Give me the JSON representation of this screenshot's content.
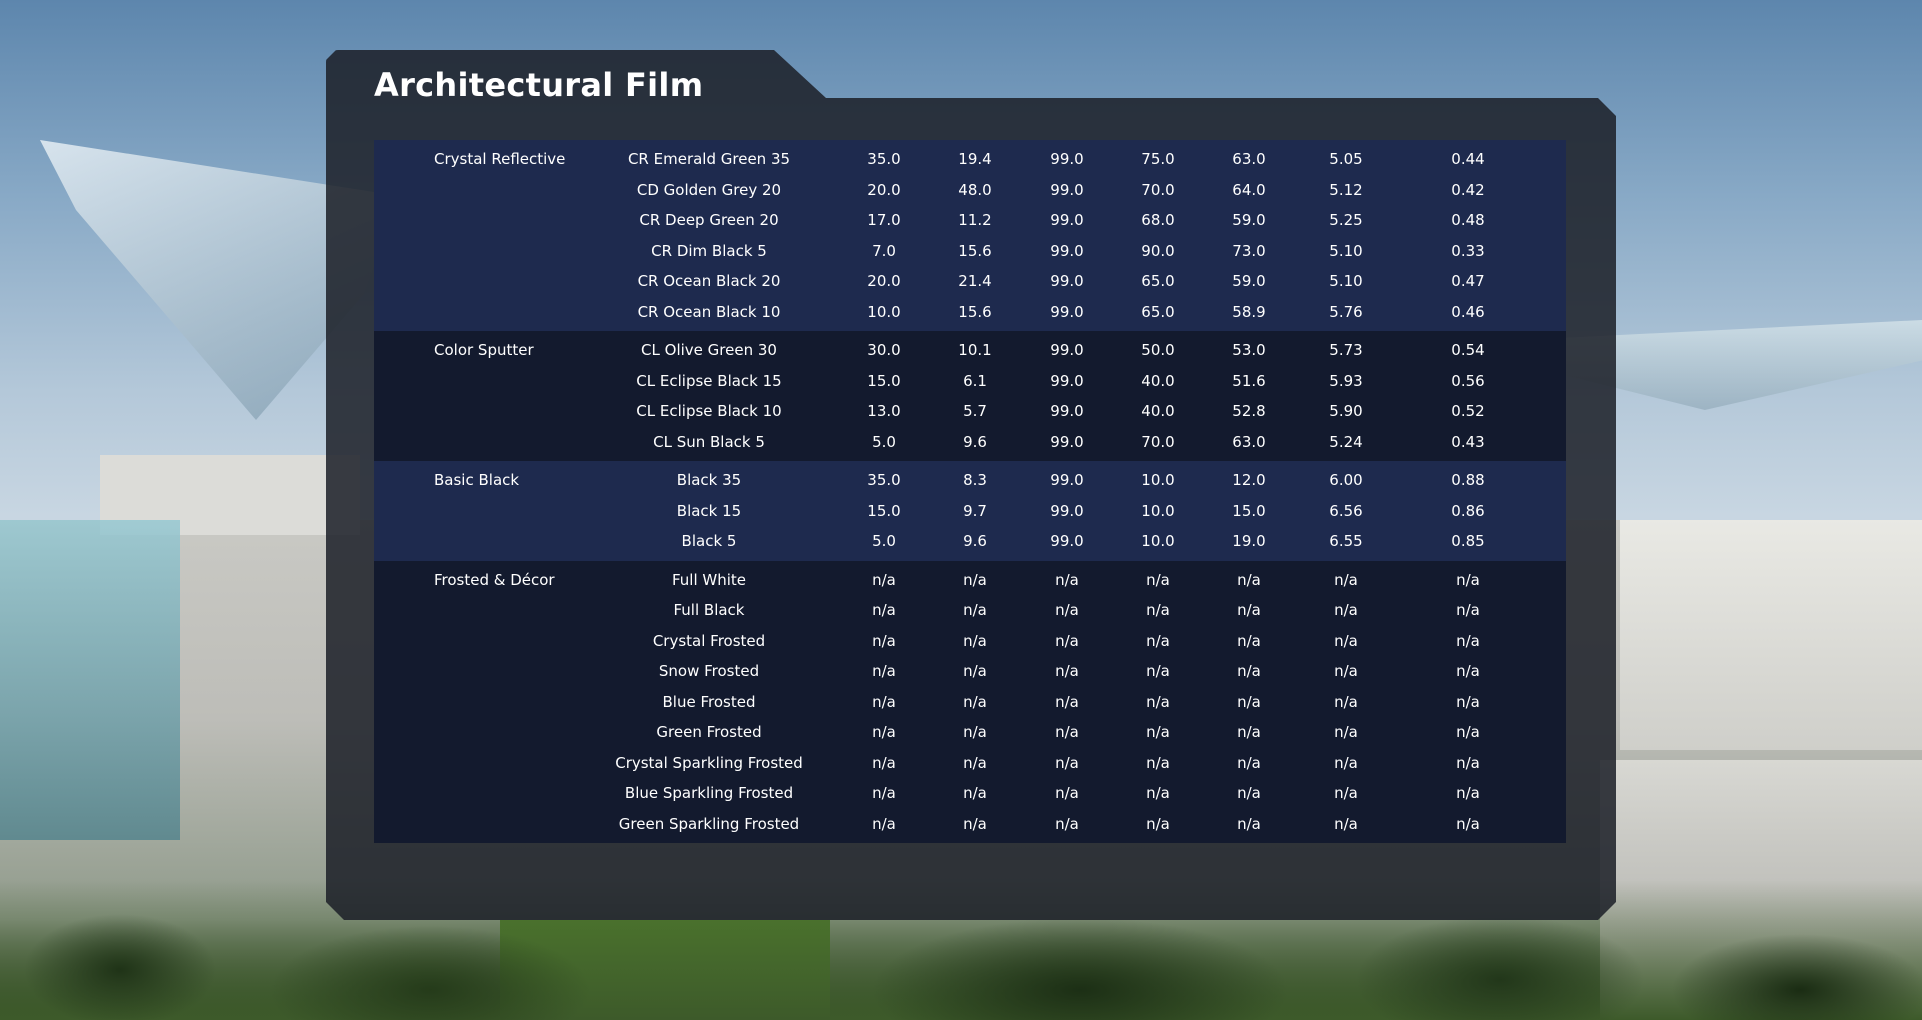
{
  "title": "Architectural Film",
  "groups": [
    {
      "name": "Crystal Reflective",
      "rows": [
        {
          "product": "CR Emerald Green 35",
          "values": [
            "35.0",
            "19.4",
            "99.0",
            "75.0",
            "63.0",
            "5.05",
            "0.44"
          ]
        },
        {
          "product": "CD Golden Grey 20",
          "values": [
            "20.0",
            "48.0",
            "99.0",
            "70.0",
            "64.0",
            "5.12",
            "0.42"
          ]
        },
        {
          "product": "CR Deep Green 20",
          "values": [
            "17.0",
            "11.2",
            "99.0",
            "68.0",
            "59.0",
            "5.25",
            "0.48"
          ]
        },
        {
          "product": "CR Dim Black 5",
          "values": [
            "7.0",
            "15.6",
            "99.0",
            "90.0",
            "73.0",
            "5.10",
            "0.33"
          ]
        },
        {
          "product": "CR Ocean Black 20",
          "values": [
            "20.0",
            "21.4",
            "99.0",
            "65.0",
            "59.0",
            "5.10",
            "0.47"
          ]
        },
        {
          "product": "CR Ocean Black 10",
          "values": [
            "10.0",
            "15.6",
            "99.0",
            "65.0",
            "58.9",
            "5.76",
            "0.46"
          ]
        }
      ]
    },
    {
      "name": "Color Sputter",
      "rows": [
        {
          "product": "CL Olive Green 30",
          "values": [
            "30.0",
            "10.1",
            "99.0",
            "50.0",
            "53.0",
            "5.73",
            "0.54"
          ]
        },
        {
          "product": "CL Eclipse Black 15",
          "values": [
            "15.0",
            "6.1",
            "99.0",
            "40.0",
            "51.6",
            "5.93",
            "0.56"
          ]
        },
        {
          "product": "CL Eclipse Black 10",
          "values": [
            "13.0",
            "5.7",
            "99.0",
            "40.0",
            "52.8",
            "5.90",
            "0.52"
          ]
        },
        {
          "product": "CL Sun Black 5",
          "values": [
            "5.0",
            "9.6",
            "99.0",
            "70.0",
            "63.0",
            "5.24",
            "0.43"
          ]
        }
      ]
    },
    {
      "name": "Basic Black",
      "rows": [
        {
          "product": "Black 35",
          "values": [
            "35.0",
            "8.3",
            "99.0",
            "10.0",
            "12.0",
            "6.00",
            "0.88"
          ]
        },
        {
          "product": "Black 15",
          "values": [
            "15.0",
            "9.7",
            "99.0",
            "10.0",
            "15.0",
            "6.56",
            "0.86"
          ]
        },
        {
          "product": "Black 5",
          "values": [
            "5.0",
            "9.6",
            "99.0",
            "10.0",
            "19.0",
            "6.55",
            "0.85"
          ]
        }
      ]
    },
    {
      "name": "Frosted & Décor",
      "rows": [
        {
          "product": "Full White",
          "values": [
            "n/a",
            "n/a",
            "n/a",
            "n/a",
            "n/a",
            "n/a",
            "n/a"
          ]
        },
        {
          "product": "Full Black",
          "values": [
            "n/a",
            "n/a",
            "n/a",
            "n/a",
            "n/a",
            "n/a",
            "n/a"
          ]
        },
        {
          "product": "Crystal Frosted",
          "values": [
            "n/a",
            "n/a",
            "n/a",
            "n/a",
            "n/a",
            "n/a",
            "n/a"
          ]
        },
        {
          "product": "Snow Frosted",
          "values": [
            "n/a",
            "n/a",
            "n/a",
            "n/a",
            "n/a",
            "n/a",
            "n/a"
          ]
        },
        {
          "product": "Blue Frosted",
          "values": [
            "n/a",
            "n/a",
            "n/a",
            "n/a",
            "n/a",
            "n/a",
            "n/a"
          ]
        },
        {
          "product": "Green Frosted",
          "values": [
            "n/a",
            "n/a",
            "n/a",
            "n/a",
            "n/a",
            "n/a",
            "n/a"
          ]
        },
        {
          "product": "Crystal Sparkling Frosted",
          "values": [
            "n/a",
            "n/a",
            "n/a",
            "n/a",
            "n/a",
            "n/a",
            "n/a"
          ]
        },
        {
          "product": "Blue Sparkling Frosted",
          "values": [
            "n/a",
            "n/a",
            "n/a",
            "n/a",
            "n/a",
            "n/a",
            "n/a"
          ]
        },
        {
          "product": "Green Sparkling Frosted",
          "values": [
            "n/a",
            "n/a",
            "n/a",
            "n/a",
            "n/a",
            "n/a",
            "n/a"
          ]
        }
      ]
    }
  ],
  "colors": {
    "panel": "#1c2028",
    "group_light": "#1e2a4e",
    "group_dark": "#131a2e",
    "text": "#ffffff"
  }
}
